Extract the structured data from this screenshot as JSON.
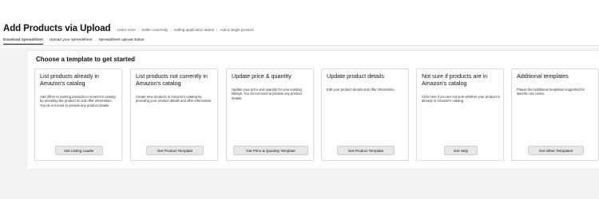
{
  "header": {
    "title": "Add Products via Upload",
    "links": [
      "Learn more",
      "Seller University",
      "Selling application status",
      "Add a single product"
    ],
    "link_separator": "|"
  },
  "tabs": [
    {
      "label": "Download Spreadsheet",
      "active": true
    },
    {
      "label": "Upload your spreadsheet",
      "active": false
    },
    {
      "label": "Spreadsheet upload status",
      "active": false
    }
  ],
  "main": {
    "heading": "Choose a template to get started",
    "cards": [
      {
        "title": "List products already in Amazon's catalog",
        "description": "Add offers to existing products in Amazon's catalog by providing the product ID and offer information. You do not need to provide any product details.",
        "button": "Get Listing Loader"
      },
      {
        "title": "List products not currently in Amazon's catalog",
        "description": "Create new products in Amazon's catalog by providing your product details and offer information.",
        "button": "Get Product Template"
      },
      {
        "title": "Update price & quantity",
        "description": "Update your price and quantity for your existing listings. You do not need to provide any product details.",
        "button": "Get Price & Quantity Template"
      },
      {
        "title": "Update product details",
        "description": "Edit your product details and offer information.",
        "button": "Get Product Template"
      },
      {
        "title": "Not sure if products are in Amazon's catalog",
        "description": "Click here if you are not sure whether your product is already in Amazon's catalog",
        "button": "Get Help"
      },
      {
        "title": "Additional templates",
        "description": "Please find additional templates supported for specific use cases.",
        "button": "Get Other Templates"
      }
    ]
  }
}
